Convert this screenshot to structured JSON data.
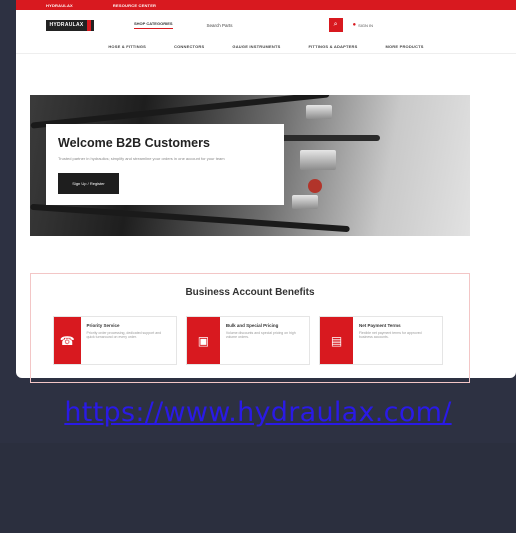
{
  "topbar": {
    "left": "HYDRAULAX",
    "right": "RESOURCE CENTER"
  },
  "header": {
    "logo": "HYDRAULAX",
    "shop_categories": "SHOP CATEGORIES",
    "search_placeholder": "Search Parts",
    "signin": "SIGN IN"
  },
  "nav": [
    "HOSE & FITTINGS",
    "CONNECTORS",
    "GAUGE INSTRUMENTS",
    "FITTINGS & ADAPTERS",
    "MORE PRODUCTS"
  ],
  "hero": {
    "title": "Welcome B2B Customers",
    "subtitle": "Trusted partner in hydraulics; simplify and streamline your orders in one account for your team",
    "button": "Sign Up / Register"
  },
  "benefits": {
    "title": "Business Account Benefits",
    "items": [
      {
        "title": "Priority Service",
        "desc": "Priority order processing, dedicated support and quick turnaround on every order."
      },
      {
        "title": "Bulk and Special Pricing",
        "desc": "Volume discounts and special pricing on high volume orders."
      },
      {
        "title": "Net Payment Terms",
        "desc": "Flexible net payment terms for approved business accounts."
      }
    ]
  },
  "url": "https://www.hydraulax.com/",
  "colors": {
    "brand": "#d8191f",
    "background": "#2d3142",
    "link": "#2a1ae6"
  }
}
